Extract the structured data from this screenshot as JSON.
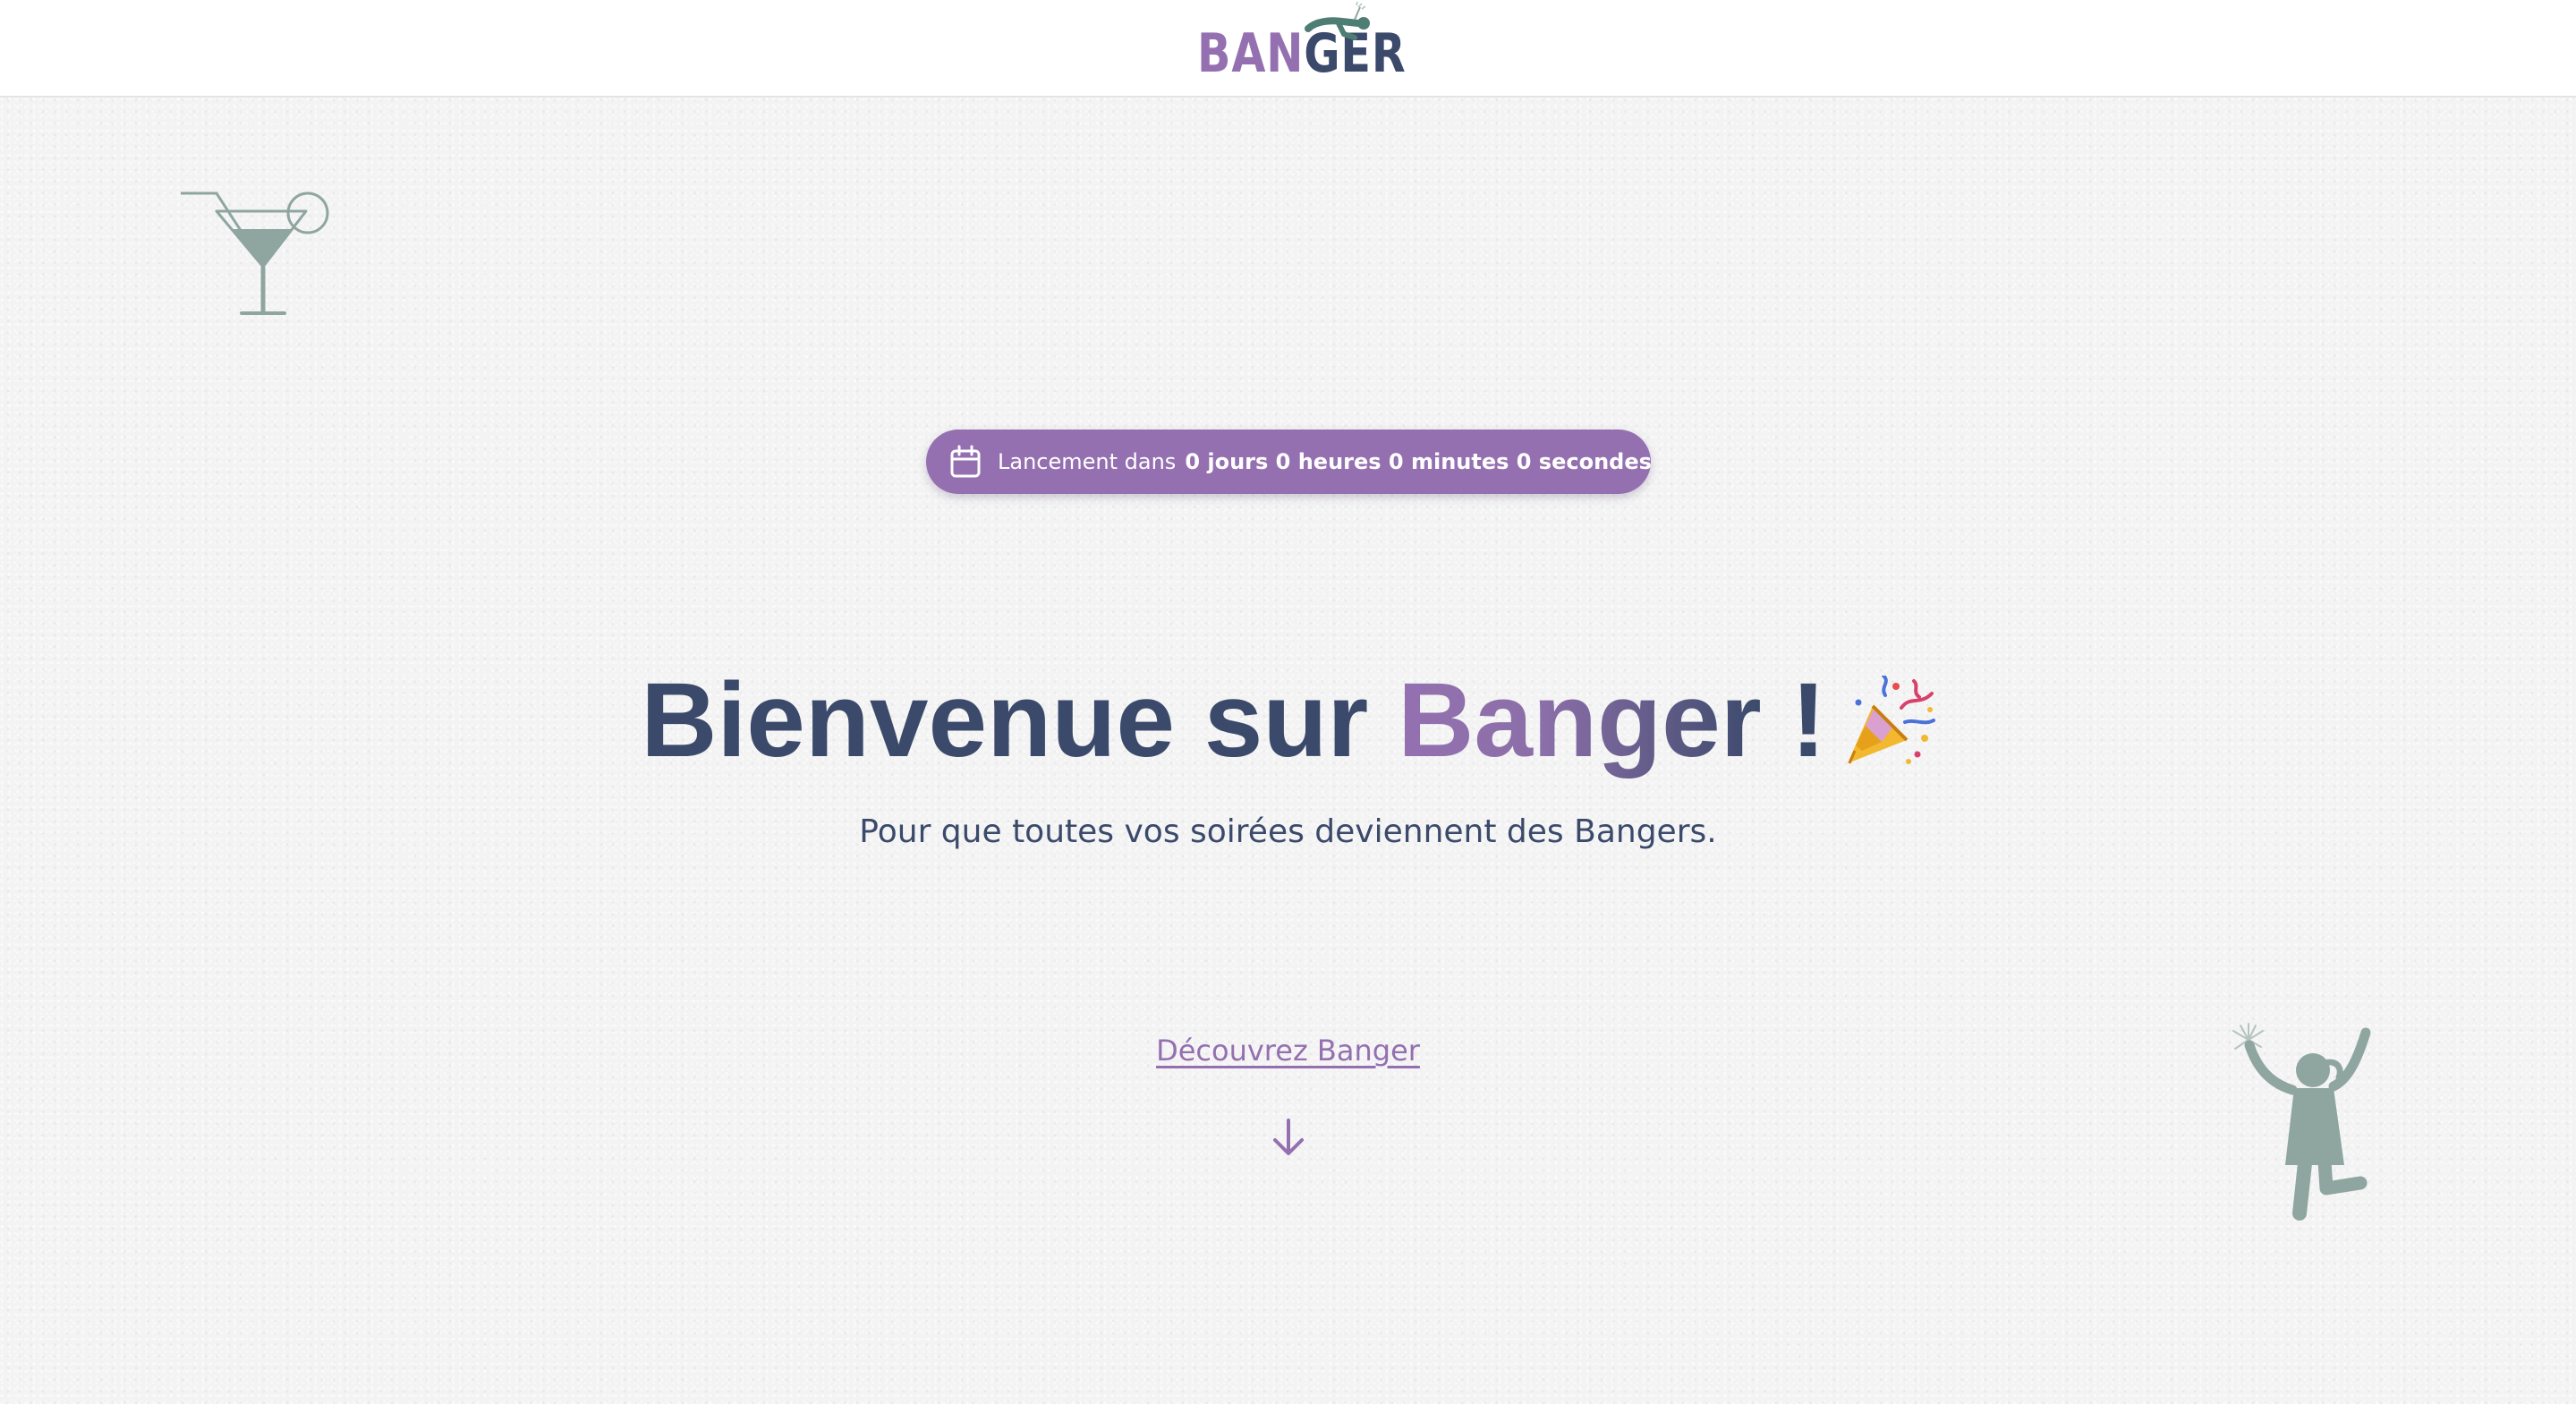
{
  "header": {
    "logo_part_a": "BAN",
    "logo_part_b": "GER"
  },
  "countdown": {
    "label": "Lancement dans",
    "values": "0 jours 0 heures 0 minutes 0 secondes"
  },
  "hero": {
    "title_prefix": "Bienvenue sur ",
    "title_brand": "Banger",
    "title_suffix": " !",
    "subtitle": "Pour que toutes vos soirées deviennent des Bangers."
  },
  "cta": {
    "discover_label": "Découvrez Banger"
  },
  "icons": {
    "calendar": "calendar-icon",
    "party": "party-popper-icon",
    "arrow": "arrow-down-icon",
    "cocktail": "cocktail-glass-icon",
    "dancer": "dancing-woman-sparkler-icon"
  },
  "colors": {
    "brand_purple": "#9470b0",
    "brand_navy": "#3b4a6b",
    "illustration_sage": "#8fa6a0",
    "background": "#f3f3f3"
  }
}
